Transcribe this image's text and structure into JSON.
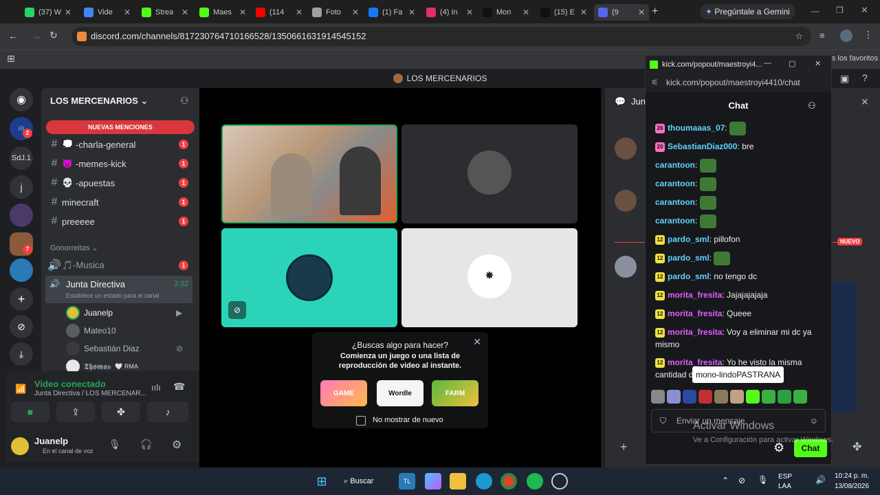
{
  "browser": {
    "tabs": [
      {
        "label": "(37) W",
        "color": "#25d366"
      },
      {
        "label": "Vide",
        "color": "#4285f4"
      },
      {
        "label": "Strea",
        "color": "#53fc18"
      },
      {
        "label": "Maes",
        "color": "#53fc18"
      },
      {
        "label": "(114",
        "color": "#ff0000"
      },
      {
        "label": "Foto",
        "color": "#9aa0a6"
      },
      {
        "label": "(1) Fa",
        "color": "#1877f2"
      },
      {
        "label": "(4) In",
        "color": "#e1306c"
      },
      {
        "label": "Mon",
        "color": "#111111"
      },
      {
        "label": "(15) E",
        "color": "#111111"
      },
      {
        "label": "(9",
        "color": "#5865f2"
      }
    ],
    "gemini_label": "Pregúntale a Gemini",
    "url": "discord.com/channels/817230764710166528/1350661631914545152",
    "bookmarks_label": "Todos los favoritos"
  },
  "discord": {
    "title": "LOS MERCENARIOS",
    "server_name": "LOS MERCENARIOS",
    "guild_labels": [
      "SdJ.1",
      "j"
    ],
    "guild_badges": [
      "2",
      "7"
    ],
    "new_mentions": "NUEVAS MENCIONES",
    "channels": [
      {
        "emoji": "💭",
        "name": "-charla-general",
        "count": "1"
      },
      {
        "emoji": "👿",
        "name": "-memes-kick",
        "count": "1"
      },
      {
        "emoji": "💀",
        "name": "-apuestas",
        "count": "1"
      },
      {
        "emoji": "",
        "name": "minecraft",
        "count": "1"
      },
      {
        "emoji": "",
        "name": "preeeee",
        "count": "1"
      }
    ],
    "category": "Gonorreitas",
    "music_channel": {
      "name": "🎵-Musica",
      "count": "1"
    },
    "voice_channel": {
      "name": "Junta Directiva",
      "time": "3:32",
      "status": "Establece un estado para el canal"
    },
    "voice_users": [
      "Juanelp",
      "Mateo10",
      "Sebastián Diaz",
      "𝕿𝖍𝖔𝖒𝖆𝖘"
    ],
    "thomas_tag": "🤍 RMA",
    "video_connected": "Video conectado",
    "video_location": "Junta Directiva / LOS MERCENAR...",
    "username": "Juanelp",
    "user_status": "En el canal de voz",
    "activity": {
      "title": "¿Buscas algo para hacer?",
      "body": "Comienza un juego o una lista de reproducción de video al instante.",
      "games": [
        "GAME",
        "Wordle",
        "FARM"
      ],
      "checkbox_label": "No mostrar de nuevo"
    },
    "right_header": "Jun",
    "nuevo_badge": "NUEVO"
  },
  "kick": {
    "window_title": "kick.com/popout/maestroyi4...",
    "url": "kick.com/popout/maestroyi4410/chat",
    "header": "Chat",
    "messages": [
      {
        "level": "26",
        "name": "thoumaaas_07",
        "name_color": "#5fd4ff",
        "text": "",
        "emote": true
      },
      {
        "level": "20",
        "name": "SebastianDiaz000",
        "name_color": "#5fd4ff",
        "text": "bre",
        "emote": false
      },
      {
        "level": "",
        "name": "carantoon",
        "name_color": "#5fd4ff",
        "text": "",
        "emote": true
      },
      {
        "level": "",
        "name": "carantoon",
        "name_color": "#5fd4ff",
        "text": "",
        "emote": true
      },
      {
        "level": "",
        "name": "carantoon",
        "name_color": "#5fd4ff",
        "text": "",
        "emote": true
      },
      {
        "level": "",
        "name": "carantoon",
        "name_color": "#5fd4ff",
        "text": "",
        "emote": true
      },
      {
        "level": "12",
        "name": "pardo_sml",
        "name_color": "#5fd4ff",
        "text": "pillofon",
        "emote": false
      },
      {
        "level": "12",
        "name": "pardo_sml",
        "name_color": "#5fd4ff",
        "text": "",
        "emote": true
      },
      {
        "level": "12",
        "name": "pardo_sml",
        "name_color": "#5fd4ff",
        "text": "no tengo dc",
        "emote": false
      },
      {
        "level": "12",
        "name": "morita_fresita",
        "name_color": "#e35cff",
        "text": "Jajajajajaja",
        "emote": false
      },
      {
        "level": "12",
        "name": "morita_fresita",
        "name_color": "#e35cff",
        "text": "Queee",
        "emote": false
      },
      {
        "level": "12",
        "name": "morita_fresita",
        "name_color": "#e35cff",
        "text": "Voy a eliminar mi dc ya mismo",
        "emote": false
      },
      {
        "level": "12",
        "name": "morita_fresita",
        "name_color": "#e35cff",
        "text": "Yo he visto la misma cantidad d",
        "emote": false
      }
    ],
    "tooltip": "mono-lindoPASTRANA",
    "input_placeholder": "Enviar un mensaje",
    "chat_button": "Chat"
  },
  "windows": {
    "activate_title": "Activar Windows",
    "activate_sub": "Ve a Configuración para activar Windows.",
    "search_label": "Buscar",
    "lang": "ESP",
    "lang2": "LAA",
    "time": "10:24 p. m.",
    "date": "13/08/2026"
  }
}
